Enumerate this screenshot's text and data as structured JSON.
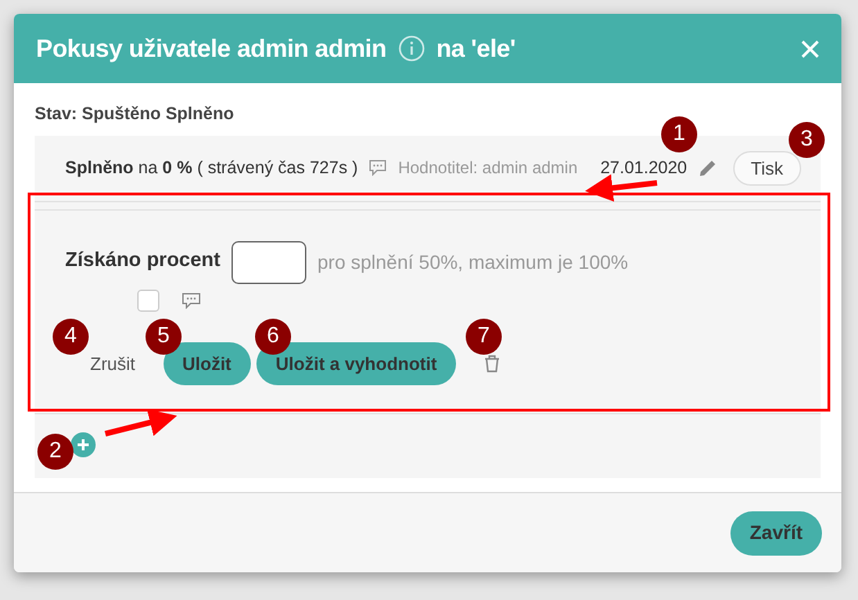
{
  "dialog": {
    "title": "Pokusy uživatele admin admin",
    "title_suffix": "na 'ele'"
  },
  "status": "Stav: Spuštěno Splněno",
  "attempt": {
    "result": "**Splněno** na **0 %** ( strávený čas 727s )",
    "evaluator": "Hodnotitel: admin admin",
    "date": "27.01.2020",
    "print_button": "Tisk"
  },
  "form": {
    "label": "Získáno procent",
    "hint": "pro splnění 50%, maximum je 100%",
    "comment_checked": false,
    "buttons": [
      {
        "label": "Zrušit",
        "kind": "link"
      },
      {
        "label": "Uložit",
        "kind": "primary"
      },
      {
        "label": "Uložit a vyhodnotit",
        "kind": "primary"
      }
    ]
  },
  "footer": {
    "close_button": "Zavřít"
  },
  "annotations": [
    {
      "number": "1"
    },
    {
      "number": "2"
    },
    {
      "number": "3"
    },
    {
      "number": "4"
    },
    {
      "number": "5"
    },
    {
      "number": "6"
    },
    {
      "number": "7"
    }
  ]
}
